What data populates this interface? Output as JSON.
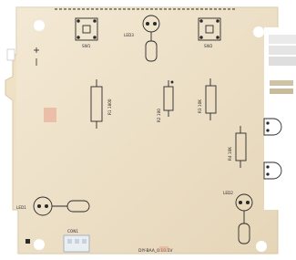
{
  "board": {
    "substrate_color": "#efe1c6",
    "silkscreen_color": "#2a2a2a",
    "labels": {
      "sw1": "SW1",
      "sw2": "SW2",
      "led1": "LED1",
      "led2": "LED2",
      "led3": "LED3",
      "r1": "R1 1800",
      "r2": "R2 100",
      "r3": "R3 10K",
      "r4": "R4 10K",
      "conn": "CON1",
      "part_number": "DIY-BAA_0.10.5V"
    }
  }
}
